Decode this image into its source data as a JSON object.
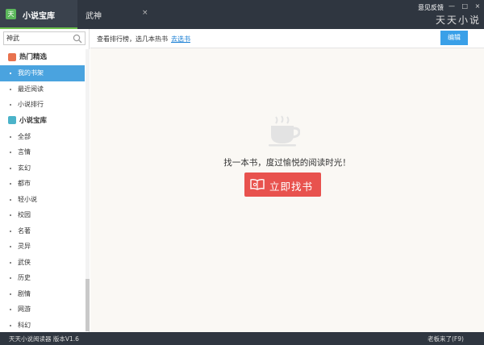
{
  "titlebar": {
    "app_tab_title": "小说宝库",
    "logo_char": "天",
    "second_tab_title": "武神",
    "second_tab_close": "×",
    "feedback": "意见反馈",
    "window_controls": "— □ ×",
    "brand": "天天小说"
  },
  "sidebar": {
    "search": {
      "value": "神武"
    },
    "section_hot": "热门精选",
    "hot_items": [
      "我的书架",
      "最近阅读",
      "小说排行"
    ],
    "section_library": "小说宝库",
    "library_items": [
      "全部",
      "言情",
      "玄幻",
      "都市",
      "轻小说",
      "校园",
      "名著",
      "灵异",
      "武侠",
      "历史",
      "剧情",
      "网游",
      "科幻"
    ]
  },
  "toolbar": {
    "hint": "查看排行榜，选几本热书",
    "hint_link": "去选书",
    "edit_label": "编辑"
  },
  "main": {
    "empty_text": "找一本书，度过愉悦的阅读时光！",
    "find_button": "立即找书"
  },
  "status": {
    "left": "天天小说阅读器   版本V1.6",
    "right": "老板来了(F9)"
  },
  "colors": {
    "titlebar": "#2f3640",
    "accent_blue": "#4aa3df",
    "find_red": "#e8524e",
    "tab_green": "#6abf4b"
  }
}
